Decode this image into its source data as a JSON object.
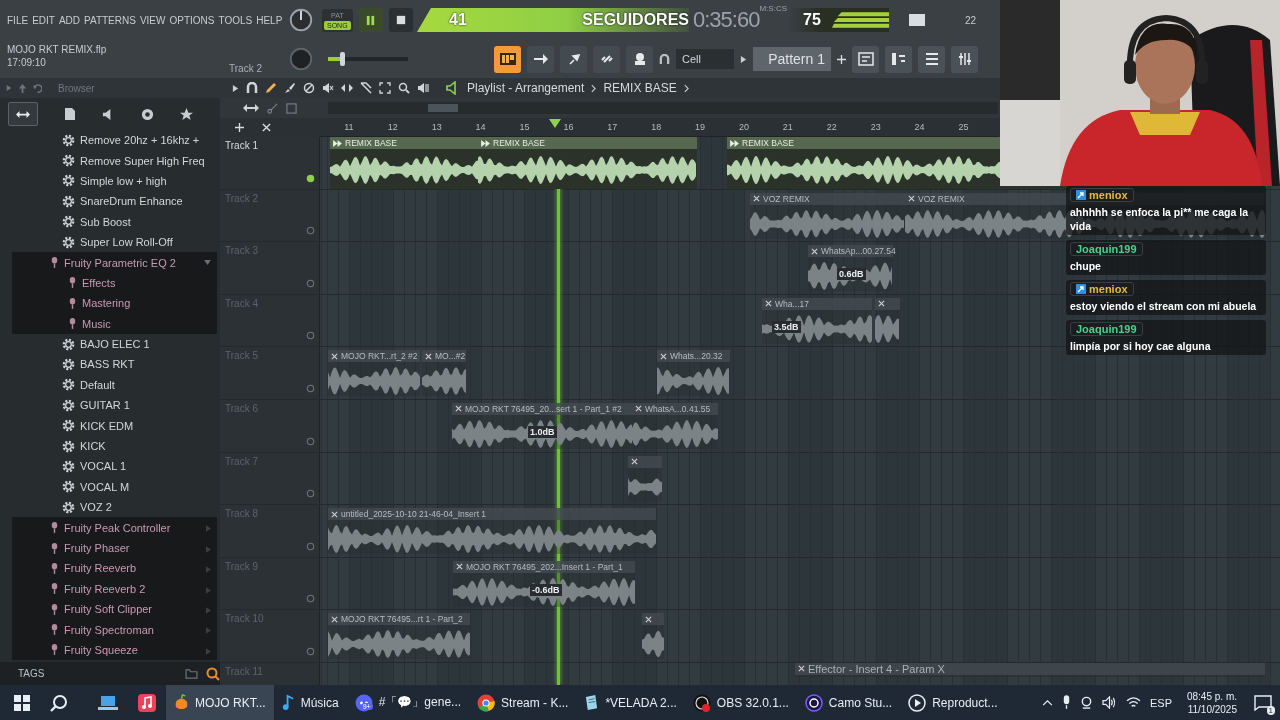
{
  "menu": [
    "FILE",
    "EDIT",
    "ADD",
    "PATTERNS",
    "VIEW",
    "OPTIONS",
    "TOOLS",
    "HELP"
  ],
  "project": {
    "file": "MOJO RKT REMIX.flp",
    "time": "17:09:10",
    "track": "Track 2"
  },
  "transport": {
    "modes": [
      {
        "label": "PAT",
        "selected": false
      },
      {
        "label": "SONG",
        "selected": true
      }
    ],
    "playing": true
  },
  "pitch_slider": {
    "level": 0.18
  },
  "overlay": {
    "followers": "41",
    "label": "SEGUIDORES",
    "goal": "75"
  },
  "clock": {
    "time": "0:35:60",
    "unit": "M:S:CS"
  },
  "cpu": "22",
  "toolbar": {
    "snap": "Cell",
    "pattern": "Pattern 1"
  },
  "browser": {
    "title": "Browser",
    "footer": "TAGS",
    "items": [
      {
        "label": "Remove 20hz + 16khz +",
        "kind": "preset"
      },
      {
        "label": "Remove Super High Freq",
        "kind": "preset"
      },
      {
        "label": "Simple low + high",
        "kind": "preset"
      },
      {
        "label": "SnareDrum Enhance",
        "kind": "preset"
      },
      {
        "label": "Sub Boost",
        "kind": "preset"
      },
      {
        "label": "Super Low Roll-Off",
        "kind": "preset"
      },
      {
        "label": "Fruity Parametric EQ 2",
        "kind": "plugin",
        "expanded": true,
        "children": [
          {
            "label": "Effects",
            "kind": "folder"
          },
          {
            "label": "Mastering",
            "kind": "folder"
          },
          {
            "label": "Music",
            "kind": "folder"
          },
          {
            "label": "BAJO ELEC 1",
            "kind": "preset"
          },
          {
            "label": "BASS RKT",
            "kind": "preset"
          },
          {
            "label": "Default",
            "kind": "preset"
          },
          {
            "label": "GUITAR 1",
            "kind": "preset"
          },
          {
            "label": "KICK EDM",
            "kind": "preset"
          },
          {
            "label": "KICK",
            "kind": "preset"
          },
          {
            "label": "VOCAL 1",
            "kind": "preset"
          },
          {
            "label": "VOCAL M",
            "kind": "preset"
          },
          {
            "label": "VOZ 2",
            "kind": "preset"
          }
        ]
      },
      {
        "label": "Fruity Peak Controller",
        "kind": "plugin",
        "expanded": false
      },
      {
        "label": "Fruity Phaser",
        "kind": "plugin",
        "expanded": false
      },
      {
        "label": "Fruity Reeverb",
        "kind": "plugin",
        "expanded": false
      },
      {
        "label": "Fruity Reeverb 2",
        "kind": "plugin",
        "expanded": false
      },
      {
        "label": "Fruity Soft Clipper",
        "kind": "plugin",
        "expanded": false
      },
      {
        "label": "Fruity Spectroman",
        "kind": "plugin",
        "expanded": false
      },
      {
        "label": "Fruity Squeeze",
        "kind": "plugin",
        "expanded": false
      }
    ]
  },
  "playlist": {
    "title": "Playlist - Arrangement",
    "path": "REMIX BASE",
    "ruler": [
      "11",
      "12",
      "13",
      "14",
      "15",
      "16",
      "17",
      "18",
      "19",
      "20",
      "21",
      "22",
      "23",
      "24",
      "25"
    ],
    "tracks": [
      {
        "name": "Track 1",
        "selected": true,
        "clips": [
          {
            "label": "REMIX BASE",
            "kind": "pattern"
          },
          {
            "label": "REMIX BASE",
            "kind": "pattern"
          },
          {
            "label": "REMIX BASE",
            "kind": "pattern"
          }
        ]
      },
      {
        "name": "Track 2",
        "selected": false,
        "clips": [
          {
            "label": "VOZ REMIX",
            "kind": "audio"
          },
          {
            "label": "VOZ REMIX",
            "kind": "audio"
          }
        ]
      },
      {
        "name": "Track 3",
        "selected": false,
        "clips": [
          {
            "label": "WhatsAp...00.27.54",
            "kind": "audio",
            "gain": "0.6dB"
          }
        ]
      },
      {
        "name": "Track 4",
        "selected": false,
        "clips": [
          {
            "label": "Wha...17",
            "kind": "audio",
            "gain": "3.5dB"
          },
          {
            "kind": "audio"
          }
        ]
      },
      {
        "name": "Track 5",
        "selected": false,
        "clips": [
          {
            "label": "MOJO RKT...rt_2 #2",
            "kind": "audio"
          },
          {
            "label": "MO...#2",
            "kind": "audio"
          },
          {
            "label": "Whats...20.32",
            "kind": "audio"
          }
        ]
      },
      {
        "name": "Track 6",
        "selected": false,
        "clips": [
          {
            "label": "MOJO RKT 76495_20...sert 1 - Part_1 #2",
            "kind": "audio",
            "gain": "1.0dB"
          },
          {
            "label": "WhatsA...0.41.55",
            "kind": "audio"
          }
        ]
      },
      {
        "name": "Track 7",
        "selected": false,
        "clips": [
          {
            "kind": "audio"
          }
        ]
      },
      {
        "name": "Track 8",
        "selected": false,
        "clips": [
          {
            "label": "untitled_2025-10-10 21-46-04_Insert 1",
            "kind": "audio"
          }
        ]
      },
      {
        "name": "Track 9",
        "selected": false,
        "clips": [
          {
            "label": "MOJO RKT 76495_202...Insert 1 - Part_1",
            "kind": "audio",
            "gain": "-0.6dB"
          }
        ]
      },
      {
        "name": "Track 10",
        "selected": false,
        "clips": [
          {
            "label": "MOJO RKT 76495...rt 1 - Part_2",
            "kind": "audio"
          },
          {
            "kind": "audio"
          }
        ]
      },
      {
        "name": "Track 11",
        "selected": false,
        "clips": [
          {
            "label": "Effector - Insert 4 - Param X",
            "kind": "automation"
          }
        ]
      }
    ]
  },
  "chat": [
    {
      "user": "meniox",
      "badge": true,
      "color": "#e6b84c",
      "text": "ahhhhh se enfoca la pi** me caga la vida"
    },
    {
      "user": "Joaquin199",
      "badge": false,
      "color": "#4fcf8c",
      "text": "chupe"
    },
    {
      "user": "meniox",
      "badge": true,
      "color": "#e6b84c",
      "text": "estoy viendo el stream con mi abuela"
    },
    {
      "user": "Joaquin199",
      "badge": false,
      "color": "#4fcf8c",
      "text": "limpía por si hoy cae alguna"
    }
  ],
  "taskbar": {
    "apps": [
      {
        "kind": "laptop",
        "selected": false
      },
      {
        "kind": "music",
        "selected": false
      },
      {
        "kind": "fl",
        "label": "MOJO RKT...",
        "selected": true
      },
      {
        "kind": "note",
        "label": "Música",
        "selected": false
      },
      {
        "kind": "discord",
        "label": "#「💬」gene...",
        "badge": "9+",
        "selected": false
      },
      {
        "kind": "chrome",
        "label": "Stream - K...",
        "selected": false
      },
      {
        "kind": "notepad",
        "label": "*VELADA 2...",
        "selected": false
      },
      {
        "kind": "obs",
        "label": "OBS 32.0.1...",
        "selected": false
      },
      {
        "kind": "camo",
        "label": "Camo Stu...",
        "selected": false
      },
      {
        "kind": "player",
        "label": "Reproduct...",
        "selected": false
      }
    ],
    "language": "ESP",
    "time": "08:45 p. m.",
    "date": "11/10/2025",
    "notifications": "1"
  }
}
